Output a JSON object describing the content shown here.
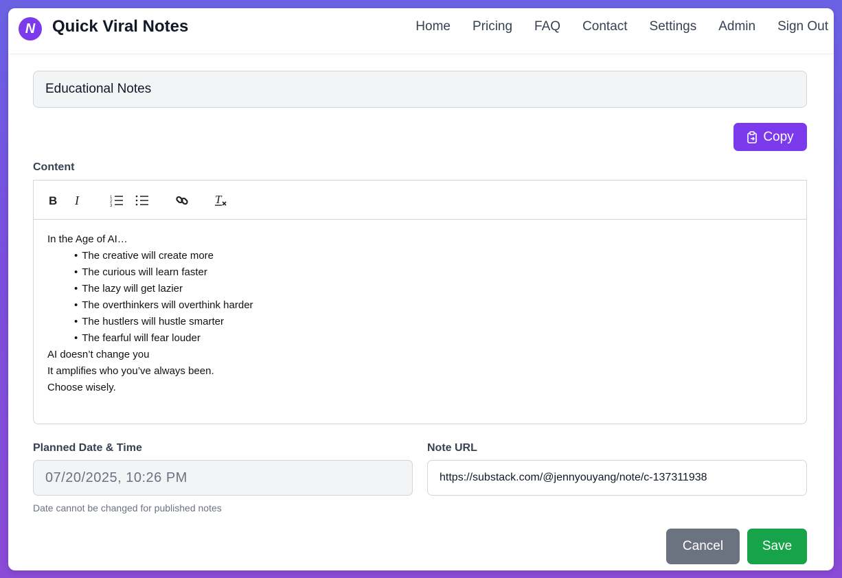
{
  "app": {
    "brand": "Quick Viral Notes",
    "logo_text": "N",
    "accent_color": "#7c3aed"
  },
  "nav": {
    "links": [
      "Home",
      "Pricing",
      "FAQ",
      "Contact",
      "Settings",
      "Admin",
      "Sign Out"
    ]
  },
  "note": {
    "title": "Educational Notes",
    "copy_label": "Copy",
    "content_label": "Content",
    "toolbar_icons": [
      "bold-icon",
      "italic-icon",
      "ordered-list-icon",
      "bullet-list-icon",
      "link-icon",
      "clear-format-icon"
    ],
    "content": {
      "intro": "In the Age of AI…",
      "bullets": [
        "The creative will create more",
        "The curious will learn faster",
        "The lazy will get lazier",
        "The overthinkers will overthink harder",
        "The hustlers will hustle smarter",
        "The fearful will fear louder"
      ],
      "closing": [
        "AI doesn’t change you",
        "It amplifies who you’ve always been.",
        "Choose wisely."
      ]
    },
    "date_label": "Planned Date & Time",
    "date_value": "07/20/2025, 10:26 PM",
    "date_hint": "Date cannot be changed for published notes",
    "url_label": "Note URL",
    "url_value": "https://substack.com/@jennyouyang/note/c-137311938"
  },
  "actions": {
    "cancel_label": "Cancel",
    "save_label": "Save"
  }
}
